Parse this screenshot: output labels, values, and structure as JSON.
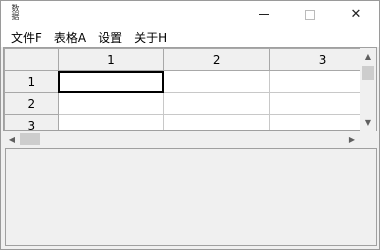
{
  "window": {
    "app_icon_glyph": "数\n据",
    "icon": "app-icon",
    "controls": {
      "close_glyph": "✕"
    }
  },
  "menu": {
    "items": [
      "文件F",
      "表格A",
      "设置",
      "关于H"
    ]
  },
  "grid": {
    "column_headers": [
      "1",
      "2",
      "3"
    ],
    "row_headers": [
      "1",
      "2",
      "3"
    ],
    "selected_cell": "R1C1"
  },
  "scrollbars": {
    "up_glyph": "▲",
    "down_glyph": "▼",
    "left_glyph": "◀",
    "right_glyph": "▶"
  }
}
